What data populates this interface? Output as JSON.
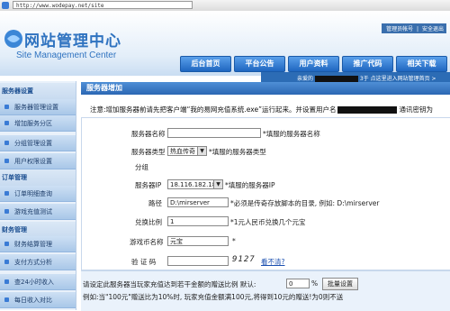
{
  "browser": {
    "url": "http://www.wodepay.net/site"
  },
  "header": {
    "title_cn": "网站管理中心",
    "title_en": "Site Management Center",
    "top_links": [
      "管理员帐号",
      "|",
      "安全退出"
    ],
    "nav": [
      "后台首页",
      "平台公告",
      "用户资料",
      "推广代码",
      "相关下载"
    ],
    "welcome_prefix": "亲爱的",
    "welcome_suffix": "3于",
    "welcome_link": "点这里进入网站管理首页 >"
  },
  "sidebar": {
    "items": [
      {
        "type": "cat",
        "label": "服务器设置"
      },
      {
        "type": "sub",
        "label": "服务器管理设置"
      },
      {
        "type": "sub",
        "label": "增加服务分区"
      },
      {
        "type": "sub",
        "label": "分组管理设置"
      },
      {
        "type": "sub",
        "label": "用户权限设置"
      },
      {
        "type": "cat",
        "label": "订单管理"
      },
      {
        "type": "sub",
        "label": "订单明细查询"
      },
      {
        "type": "sub",
        "label": "游戏充值测试"
      },
      {
        "type": "cat",
        "label": "财务管理"
      },
      {
        "type": "sub",
        "label": "财务结算管理"
      },
      {
        "type": "sub",
        "label": "支付方式分析"
      },
      {
        "type": "sub",
        "label": "查24小时收入"
      },
      {
        "type": "sub",
        "label": "每日收入对比"
      }
    ]
  },
  "panel": {
    "title": "服务器增加",
    "notice": "注意:增加服务器前请先把客户端“我的易网充值系统.exe”运行起来。并设置用户名",
    "notice_tail": "通讯密钥为"
  },
  "form": {
    "server_name_label": "服务器名称",
    "server_name_value": "",
    "server_name_hint": "*填服的服务器名称",
    "server_type_label": "服务器类型",
    "server_type_value": "热血传奇",
    "server_type_hint": "*填服的服务器类型",
    "group_label": "分组",
    "server_ip_label": "服务器IP",
    "server_ip_value": "18.116.182.183",
    "server_ip_hint": "*填服的服务器IP",
    "path_label": "路径",
    "path_value": "D:\\mirserver",
    "path_hint": "*必须是传奇存放脚本的目录, 例如: D:\\mirserver",
    "ratio_label": "兑换比例",
    "ratio_value": "1",
    "ratio_hint": "*1元人民币兑换几个元宝",
    "currency_label": "游戏币名称",
    "currency_value": "元宝",
    "currency_hint": "*",
    "captcha_label": "验 证 码",
    "captcha_value": "",
    "captcha_image": "9127",
    "captcha_refresh": "看不清?"
  },
  "bottom": {
    "line1_prefix": "请设定此服务器当玩家充值达到若干金额的赠送比例 默认:",
    "percent_value": "0",
    "percent_unit": "%",
    "batch_button": "批量设置",
    "line2": "例如:当\"100元\"赠送比为10%时, 玩家充值金额满100元,将得到10元的赠送!为0则不送"
  }
}
